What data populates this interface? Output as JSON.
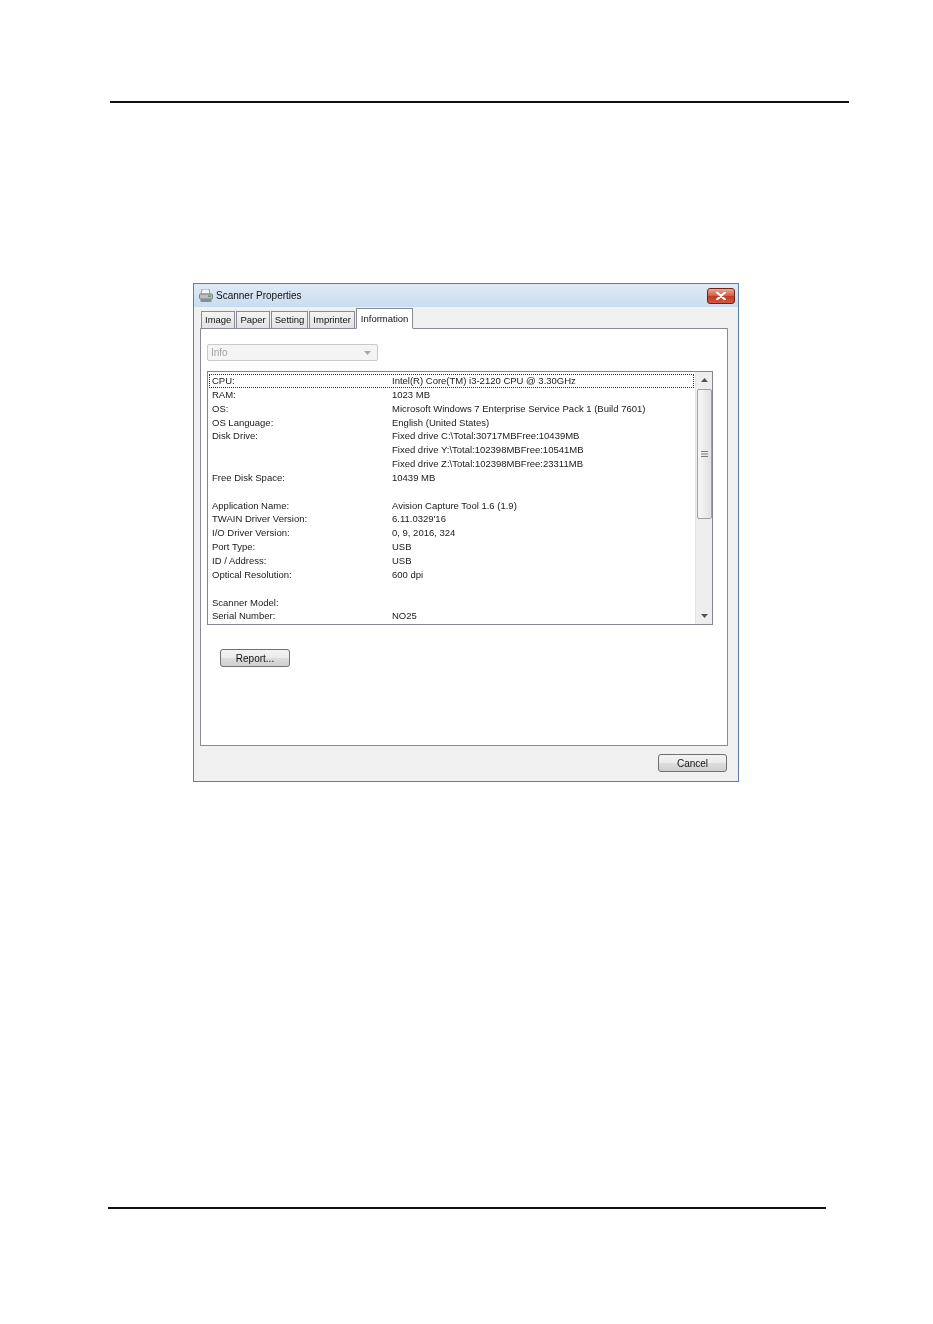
{
  "window": {
    "title": "Scanner Properties"
  },
  "tabs": [
    {
      "label": "Image",
      "selected": false
    },
    {
      "label": "Paper",
      "selected": false
    },
    {
      "label": "Setting",
      "selected": false
    },
    {
      "label": "Imprinter",
      "selected": false
    },
    {
      "label": "Information",
      "selected": true
    }
  ],
  "dropdown": {
    "value": "Info",
    "disabled": true
  },
  "info_list": {
    "sections": [
      {
        "rows": [
          {
            "label": "CPU:",
            "values": [
              "Intel(R) Core(TM) i3-2120 CPU @ 3.30GHz"
            ],
            "selected": true
          },
          {
            "label": "RAM:",
            "values": [
              "1023 MB"
            ],
            "selected": false
          },
          {
            "label": "OS:",
            "values": [
              "Microsoft Windows 7 Enterprise Service Pack 1 (Build 7601)"
            ],
            "selected": false
          },
          {
            "label": "OS Language:",
            "values": [
              "English (United States)"
            ],
            "selected": false
          },
          {
            "label": "Disk Drive:",
            "values": [
              "Fixed drive C:\\Total:30717MBFree:10439MB",
              "Fixed drive Y:\\Total:102398MBFree:10541MB",
              "Fixed drive Z:\\Total:102398MBFree:23311MB"
            ],
            "selected": false
          },
          {
            "label": "Free Disk Space:",
            "values": [
              "10439 MB"
            ],
            "selected": false
          }
        ]
      },
      {
        "rows": [
          {
            "label": "Application Name:",
            "values": [
              "Avision Capture Tool 1.6 (1.9)"
            ],
            "selected": false
          },
          {
            "label": "TWAIN Driver Version:",
            "values": [
              "6.11.0329'16"
            ],
            "selected": false
          },
          {
            "label": "I/O Driver Version:",
            "values": [
              "0, 9, 2016, 324"
            ],
            "selected": false
          },
          {
            "label": "Port Type:",
            "values": [
              "USB"
            ],
            "selected": false
          },
          {
            "label": "ID / Address:",
            "values": [
              "USB"
            ],
            "selected": false
          },
          {
            "label": "Optical Resolution:",
            "values": [
              "600 dpi"
            ],
            "selected": false
          }
        ]
      },
      {
        "rows": [
          {
            "label": "Scanner Model:",
            "selected": false
          },
          {
            "label": "Serial Number:",
            "values": [
              "NO25"
            ],
            "selected": false
          }
        ]
      }
    ]
  },
  "report_button": {
    "label": "Report..."
  },
  "cancel_button": {
    "label": "Cancel"
  }
}
